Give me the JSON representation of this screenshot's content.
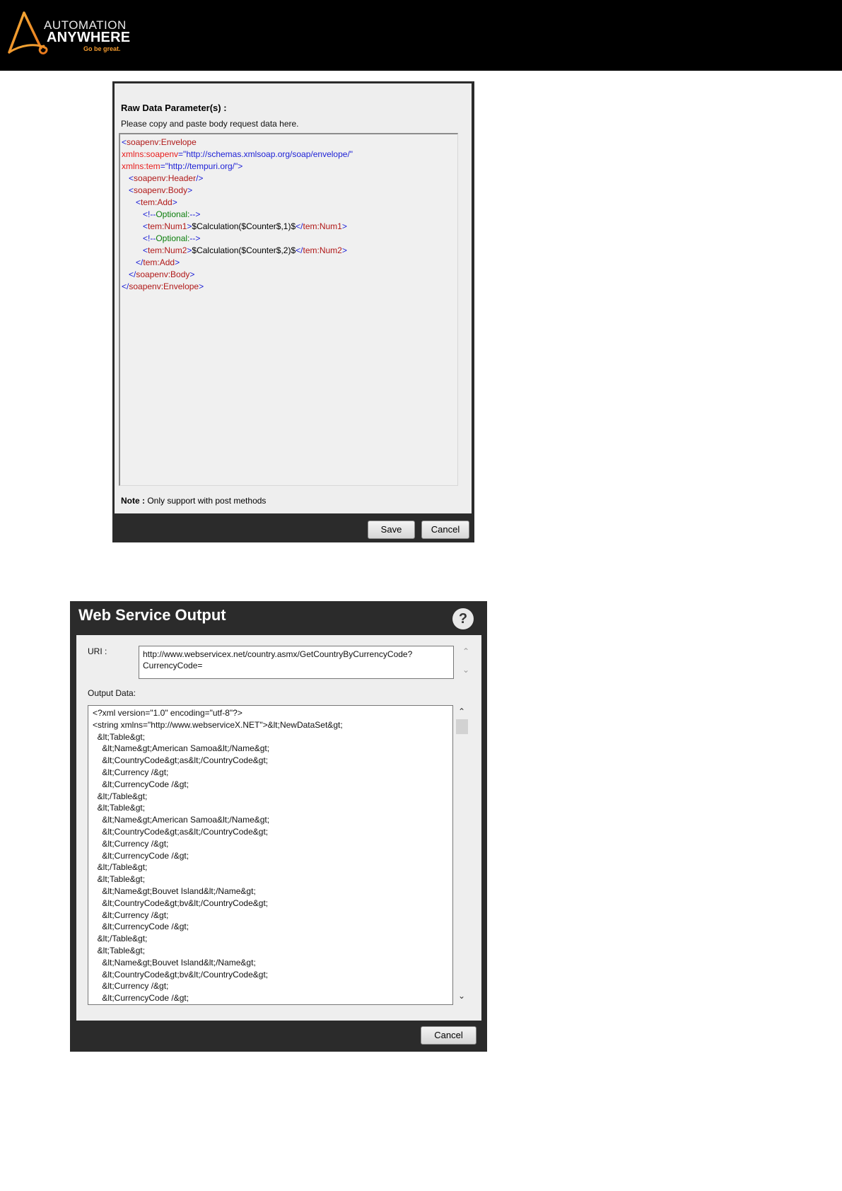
{
  "brand": {
    "name_line1": "AUTOMATION",
    "name_line2": "ANYWHERE",
    "tagline": "Go be great."
  },
  "raw_data_dialog": {
    "heading": "Raw Data Parameter(s) :",
    "hint": "Please copy and paste body request data here.",
    "note_label": "Note :",
    "note_text": " Only support with post methods",
    "save_label": "Save",
    "cancel_label": "Cancel",
    "xml_lines": [
      [
        {
          "t": "<",
          "c": "b"
        },
        {
          "t": "soapenv:Envelope",
          "c": "t"
        }
      ],
      [
        {
          "t": "xmlns:soapenv",
          "c": "a"
        },
        {
          "t": "=\"http://schemas.xmlsoap.org/soap/envelope/\"",
          "c": "v"
        }
      ],
      [
        {
          "t": "xmlns:tem",
          "c": "a"
        },
        {
          "t": "=\"http://tempuri.org/\">",
          "c": "v"
        }
      ],
      [
        {
          "t": "   <",
          "c": "b"
        },
        {
          "t": "soapenv:Header",
          "c": "t"
        },
        {
          "t": "/>",
          "c": "b"
        }
      ],
      [
        {
          "t": "   <",
          "c": "b"
        },
        {
          "t": "soapenv:Body",
          "c": "t"
        },
        {
          "t": ">",
          "c": "b"
        }
      ],
      [
        {
          "t": "      <",
          "c": "b"
        },
        {
          "t": "tem:Add",
          "c": "t"
        },
        {
          "t": ">",
          "c": "b"
        }
      ],
      [
        {
          "t": "         <!--",
          "c": "b"
        },
        {
          "t": "Optional:",
          "c": "c"
        },
        {
          "t": "-->",
          "c": "b"
        }
      ],
      [
        {
          "t": "         <",
          "c": "b"
        },
        {
          "t": "tem:Num1",
          "c": "t"
        },
        {
          "t": ">",
          "c": "b"
        },
        {
          "t": "$Calculation($Counter$,1)$",
          "c": "x"
        },
        {
          "t": "</",
          "c": "b"
        },
        {
          "t": "tem:Num1",
          "c": "t"
        },
        {
          "t": ">",
          "c": "b"
        }
      ],
      [
        {
          "t": "         <!--",
          "c": "b"
        },
        {
          "t": "Optional:",
          "c": "c"
        },
        {
          "t": "-->",
          "c": "b"
        }
      ],
      [
        {
          "t": "         <",
          "c": "b"
        },
        {
          "t": "tem:Num2",
          "c": "t"
        },
        {
          "t": ">",
          "c": "b"
        },
        {
          "t": "$Calculation($Counter$,2)$",
          "c": "x"
        },
        {
          "t": "</",
          "c": "b"
        },
        {
          "t": "tem:Num2",
          "c": "t"
        },
        {
          "t": ">",
          "c": "b"
        }
      ],
      [
        {
          "t": "      </",
          "c": "b"
        },
        {
          "t": "tem:Add",
          "c": "t"
        },
        {
          "t": ">",
          "c": "b"
        }
      ],
      [
        {
          "t": "   </",
          "c": "b"
        },
        {
          "t": "soapenv:Body",
          "c": "t"
        },
        {
          "t": ">",
          "c": "b"
        }
      ],
      [
        {
          "t": "</",
          "c": "b"
        },
        {
          "t": "soapenv:Envelope",
          "c": "t"
        },
        {
          "t": ">",
          "c": "b"
        }
      ]
    ]
  },
  "output_dialog": {
    "title": "Web Service Output",
    "help_symbol": "?",
    "uri_label": "URI :",
    "uri_line1": "http://www.webservicex.net/country.asmx/GetCountryByCurrencyCode?",
    "uri_line2": "CurrencyCode=",
    "output_label": "Output Data:",
    "cancel_label": "Cancel",
    "output_lines": [
      "<?xml version=\"1.0\" encoding=\"utf-8\"?>",
      "<string xmlns=\"http://www.webserviceX.NET\">&lt;NewDataSet&gt;",
      "  &lt;Table&gt;",
      "    &lt;Name&gt;American Samoa&lt;/Name&gt;",
      "    &lt;CountryCode&gt;as&lt;/CountryCode&gt;",
      "    &lt;Currency /&gt;",
      "    &lt;CurrencyCode /&gt;",
      "  &lt;/Table&gt;",
      "  &lt;Table&gt;",
      "    &lt;Name&gt;American Samoa&lt;/Name&gt;",
      "    &lt;CountryCode&gt;as&lt;/CountryCode&gt;",
      "    &lt;Currency /&gt;",
      "    &lt;CurrencyCode /&gt;",
      "  &lt;/Table&gt;",
      "  &lt;Table&gt;",
      "    &lt;Name&gt;Bouvet Island&lt;/Name&gt;",
      "    &lt;CountryCode&gt;bv&lt;/CountryCode&gt;",
      "    &lt;Currency /&gt;",
      "    &lt;CurrencyCode /&gt;",
      "  &lt;/Table&gt;",
      "  &lt;Table&gt;",
      "    &lt;Name&gt;Bouvet Island&lt;/Name&gt;",
      "    &lt;CountryCode&gt;bv&lt;/CountryCode&gt;",
      "    &lt;Currency /&gt;",
      "    &lt;CurrencyCode /&gt;"
    ]
  },
  "colors": {
    "xml_bracket": "#1f22d6",
    "xml_tag": "#b01818",
    "xml_attr": "#e81c1c",
    "xml_comment": "#0a7d0a",
    "brand_orange": "#f29a2e"
  }
}
